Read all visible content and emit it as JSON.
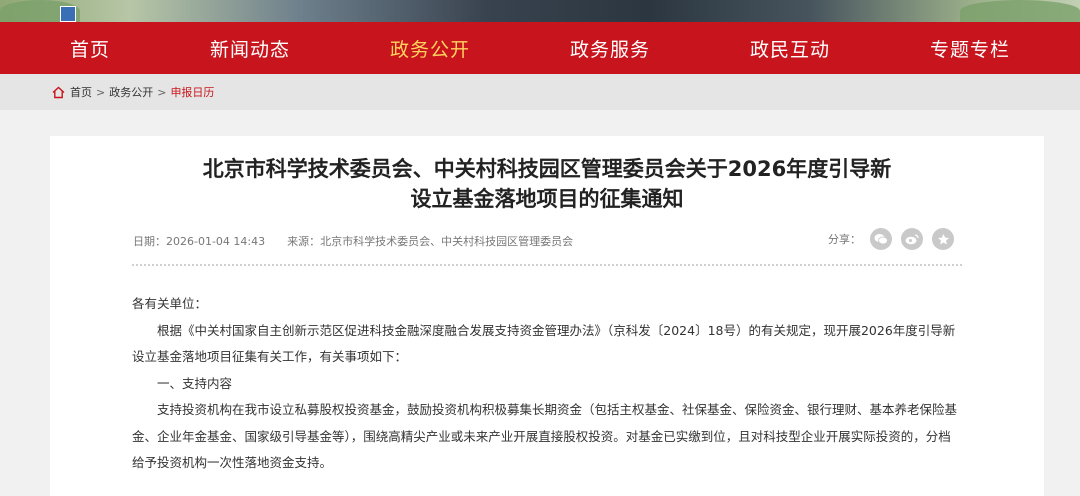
{
  "nav": {
    "items": [
      {
        "label": "首页",
        "active": false
      },
      {
        "label": "新闻动态",
        "active": false
      },
      {
        "label": "政务公开",
        "active": true
      },
      {
        "label": "政务服务",
        "active": false
      },
      {
        "label": "政民互动",
        "active": false
      },
      {
        "label": "专题专栏",
        "active": false
      }
    ]
  },
  "breadcrumb": {
    "home": "首页",
    "sep": ">",
    "level1": "政务公开",
    "current": "申报日历"
  },
  "article": {
    "title_line1": "北京市科学技术委员会、中关村科技园区管理委员会关于2026年度引导新",
    "title_line2": "设立基金落地项目的征集通知",
    "date": "日期：2026-01-04 14:43",
    "source": "来源：北京市科学技术委员会、中关村科技园区管理委员会",
    "share_label": "分享：",
    "paragraphs": [
      "各有关单位：",
      "根据《中关村国家自主创新示范区促进科技金融深度融合发展支持资金管理办法》（京科发〔2024〕18号）的有关规定，现开展2026年度引导新设立基金落地项目征集有关工作，有关事项如下：",
      "一、支持内容",
      "支持投资机构在我市设立私募股权投资基金，鼓励投资机构积极募集长期资金（包括主权基金、社保基金、保险资金、银行理财、基本养老保险基金、企业年金基金、国家级引导基金等），围绕高精尖产业或未来产业开展直接股权投资。对基金已实缴到位，且对科技型企业开展实际投资的，分档给予投资机构一次性落地资金支持。"
    ]
  },
  "colors": {
    "nav_bg": "#c8151d",
    "nav_active": "#ffd45e",
    "breadcrumb_current": "#c8151d"
  },
  "icons": [
    "home-icon",
    "wechat-icon",
    "weibo-icon",
    "favorite-star-icon"
  ]
}
